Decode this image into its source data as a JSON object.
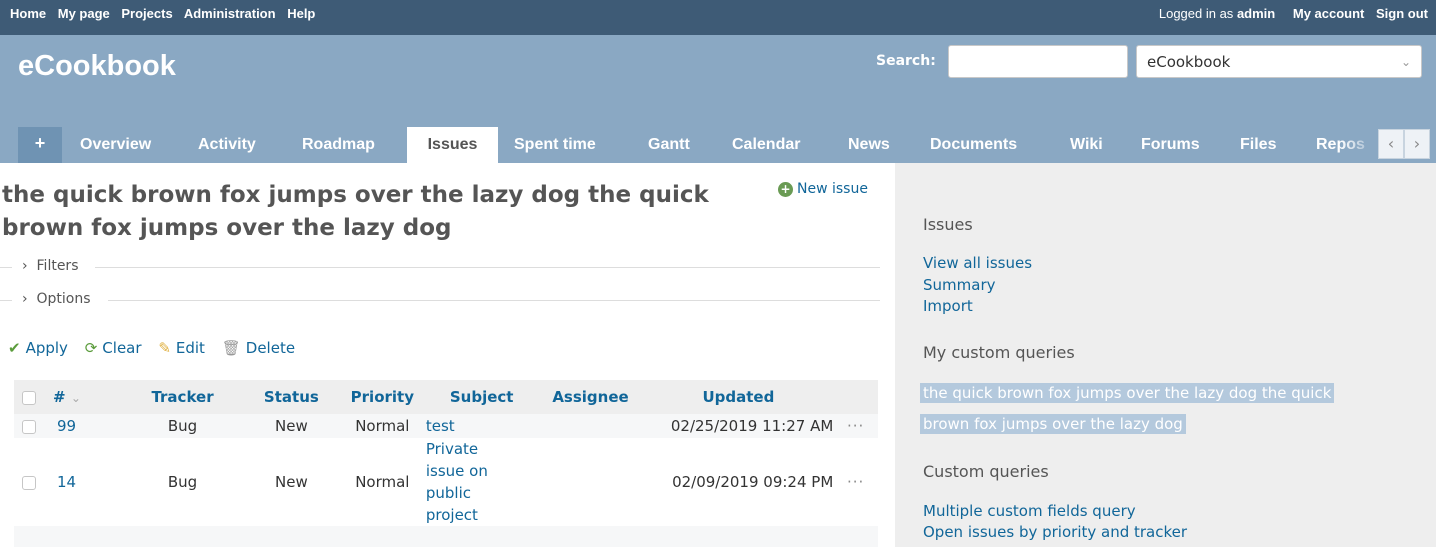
{
  "top_menu": {
    "items": [
      "Home",
      "My page",
      "Projects",
      "Administration",
      "Help"
    ],
    "logged_as_prefix": "Logged in as",
    "logged_as_user": "admin",
    "my_account": "My account",
    "sign_out": "Sign out"
  },
  "header": {
    "title": "eCookbook",
    "search_label": "Search:",
    "search_value": "",
    "project_select": "eCookbook"
  },
  "main_menu": {
    "plus": "+",
    "tabs": [
      "Overview",
      "Activity",
      "Roadmap",
      "Issues",
      "Spent time",
      "Gantt",
      "Calendar",
      "News",
      "Documents",
      "Wiki",
      "Forums",
      "Files",
      "Repos"
    ],
    "selected": "Issues"
  },
  "content": {
    "title_line1": "the quick brown fox jumps over the lazy dog the quick",
    "title_line2": "brown fox jumps over the lazy dog",
    "new_issue": "New issue",
    "filters": "Filters",
    "options": "Options",
    "actions": {
      "apply": "Apply",
      "clear": "Clear",
      "edit": "Edit",
      "delete": "Delete"
    },
    "table": {
      "headers": [
        "#",
        "Tracker",
        "Status",
        "Priority",
        "Subject",
        "Assignee",
        "Updated"
      ],
      "rows": [
        {
          "id": "99",
          "tracker": "Bug",
          "status": "New",
          "priority": "Normal",
          "subject": "test",
          "assignee": "",
          "updated": "02/25/2019 11:27 AM"
        },
        {
          "id": "14",
          "tracker": "Bug",
          "status": "New",
          "priority": "Normal",
          "subject_lines": [
            "Private",
            "issue on",
            "public",
            "project"
          ],
          "assignee": "",
          "updated": "02/09/2019 09:24 PM"
        }
      ],
      "more_dots": "···"
    }
  },
  "sidebar": {
    "issues_heading": "Issues",
    "links": [
      "View all issues",
      "Summary",
      "Import"
    ],
    "my_queries_heading": "My custom queries",
    "my_query_line1": "the quick brown fox jumps over the lazy dog the quick",
    "my_query_line2": "brown fox jumps over the lazy dog",
    "custom_queries_heading": "Custom queries",
    "custom_queries": [
      "Multiple custom fields query",
      "Open issues by priority and tracker"
    ]
  },
  "colors": {
    "top_menu_bg": "#3e5b76",
    "header_bg": "#8aa8c3",
    "link": "#116699",
    "sidebar_bg": "#eeeeee"
  }
}
